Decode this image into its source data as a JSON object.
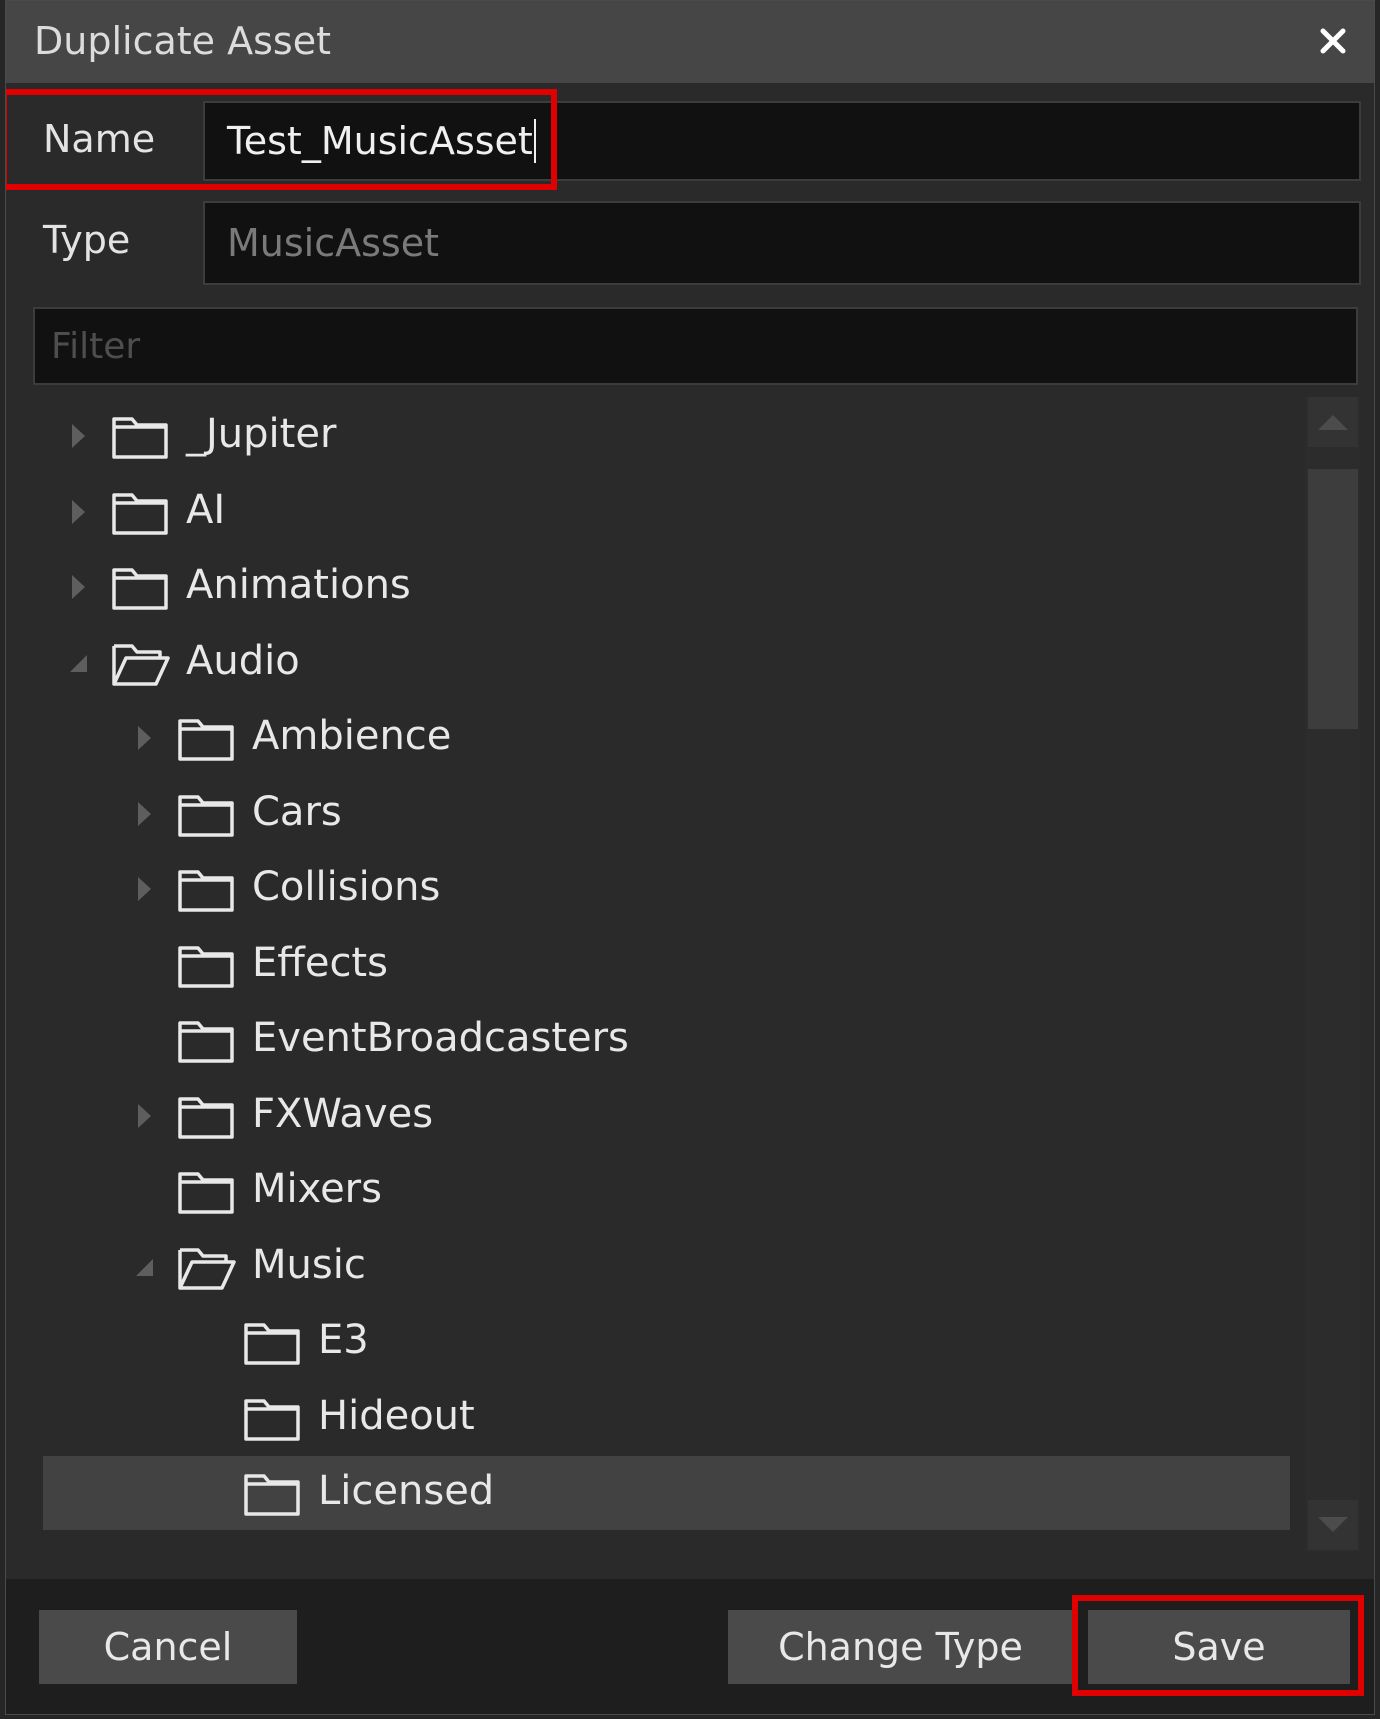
{
  "dialog": {
    "title": "Duplicate Asset",
    "close_glyph": "×"
  },
  "form": {
    "name_label": "Name",
    "name_value": "Test_MusicAsset",
    "type_label": "Type",
    "type_value": "MusicAsset",
    "filter_placeholder": "Filter"
  },
  "tree": {
    "items": [
      {
        "label": "_Jupiter",
        "depth": 0,
        "expander": "collapsed",
        "icon": "folder-icon"
      },
      {
        "label": "AI",
        "depth": 0,
        "expander": "collapsed",
        "icon": "folder-icon"
      },
      {
        "label": "Animations",
        "depth": 0,
        "expander": "collapsed",
        "icon": "folder-icon"
      },
      {
        "label": "Audio",
        "depth": 0,
        "expander": "expanded",
        "icon": "folder-open-icon"
      },
      {
        "label": "Ambience",
        "depth": 1,
        "expander": "collapsed",
        "icon": "folder-icon"
      },
      {
        "label": "Cars",
        "depth": 1,
        "expander": "collapsed",
        "icon": "folder-icon"
      },
      {
        "label": "Collisions",
        "depth": 1,
        "expander": "collapsed",
        "icon": "folder-icon"
      },
      {
        "label": "Effects",
        "depth": 1,
        "expander": "none",
        "icon": "folder-icon"
      },
      {
        "label": "EventBroadcasters",
        "depth": 1,
        "expander": "none",
        "icon": "folder-icon"
      },
      {
        "label": "FXWaves",
        "depth": 1,
        "expander": "collapsed",
        "icon": "folder-icon"
      },
      {
        "label": "Mixers",
        "depth": 1,
        "expander": "none",
        "icon": "folder-icon"
      },
      {
        "label": "Music",
        "depth": 1,
        "expander": "expanded",
        "icon": "folder-open-icon"
      },
      {
        "label": "E3",
        "depth": 2,
        "expander": "none",
        "icon": "folder-icon"
      },
      {
        "label": "Hideout",
        "depth": 2,
        "expander": "none",
        "icon": "folder-icon"
      },
      {
        "label": "Licensed",
        "depth": 2,
        "expander": "none",
        "icon": "folder-icon",
        "selected": true
      }
    ]
  },
  "footer": {
    "cancel_label": "Cancel",
    "change_type_label": "Change Type",
    "save_label": "Save"
  },
  "colors": {
    "highlight": "#e10000",
    "selected_row": "#424242",
    "titlebar": "#464646"
  }
}
